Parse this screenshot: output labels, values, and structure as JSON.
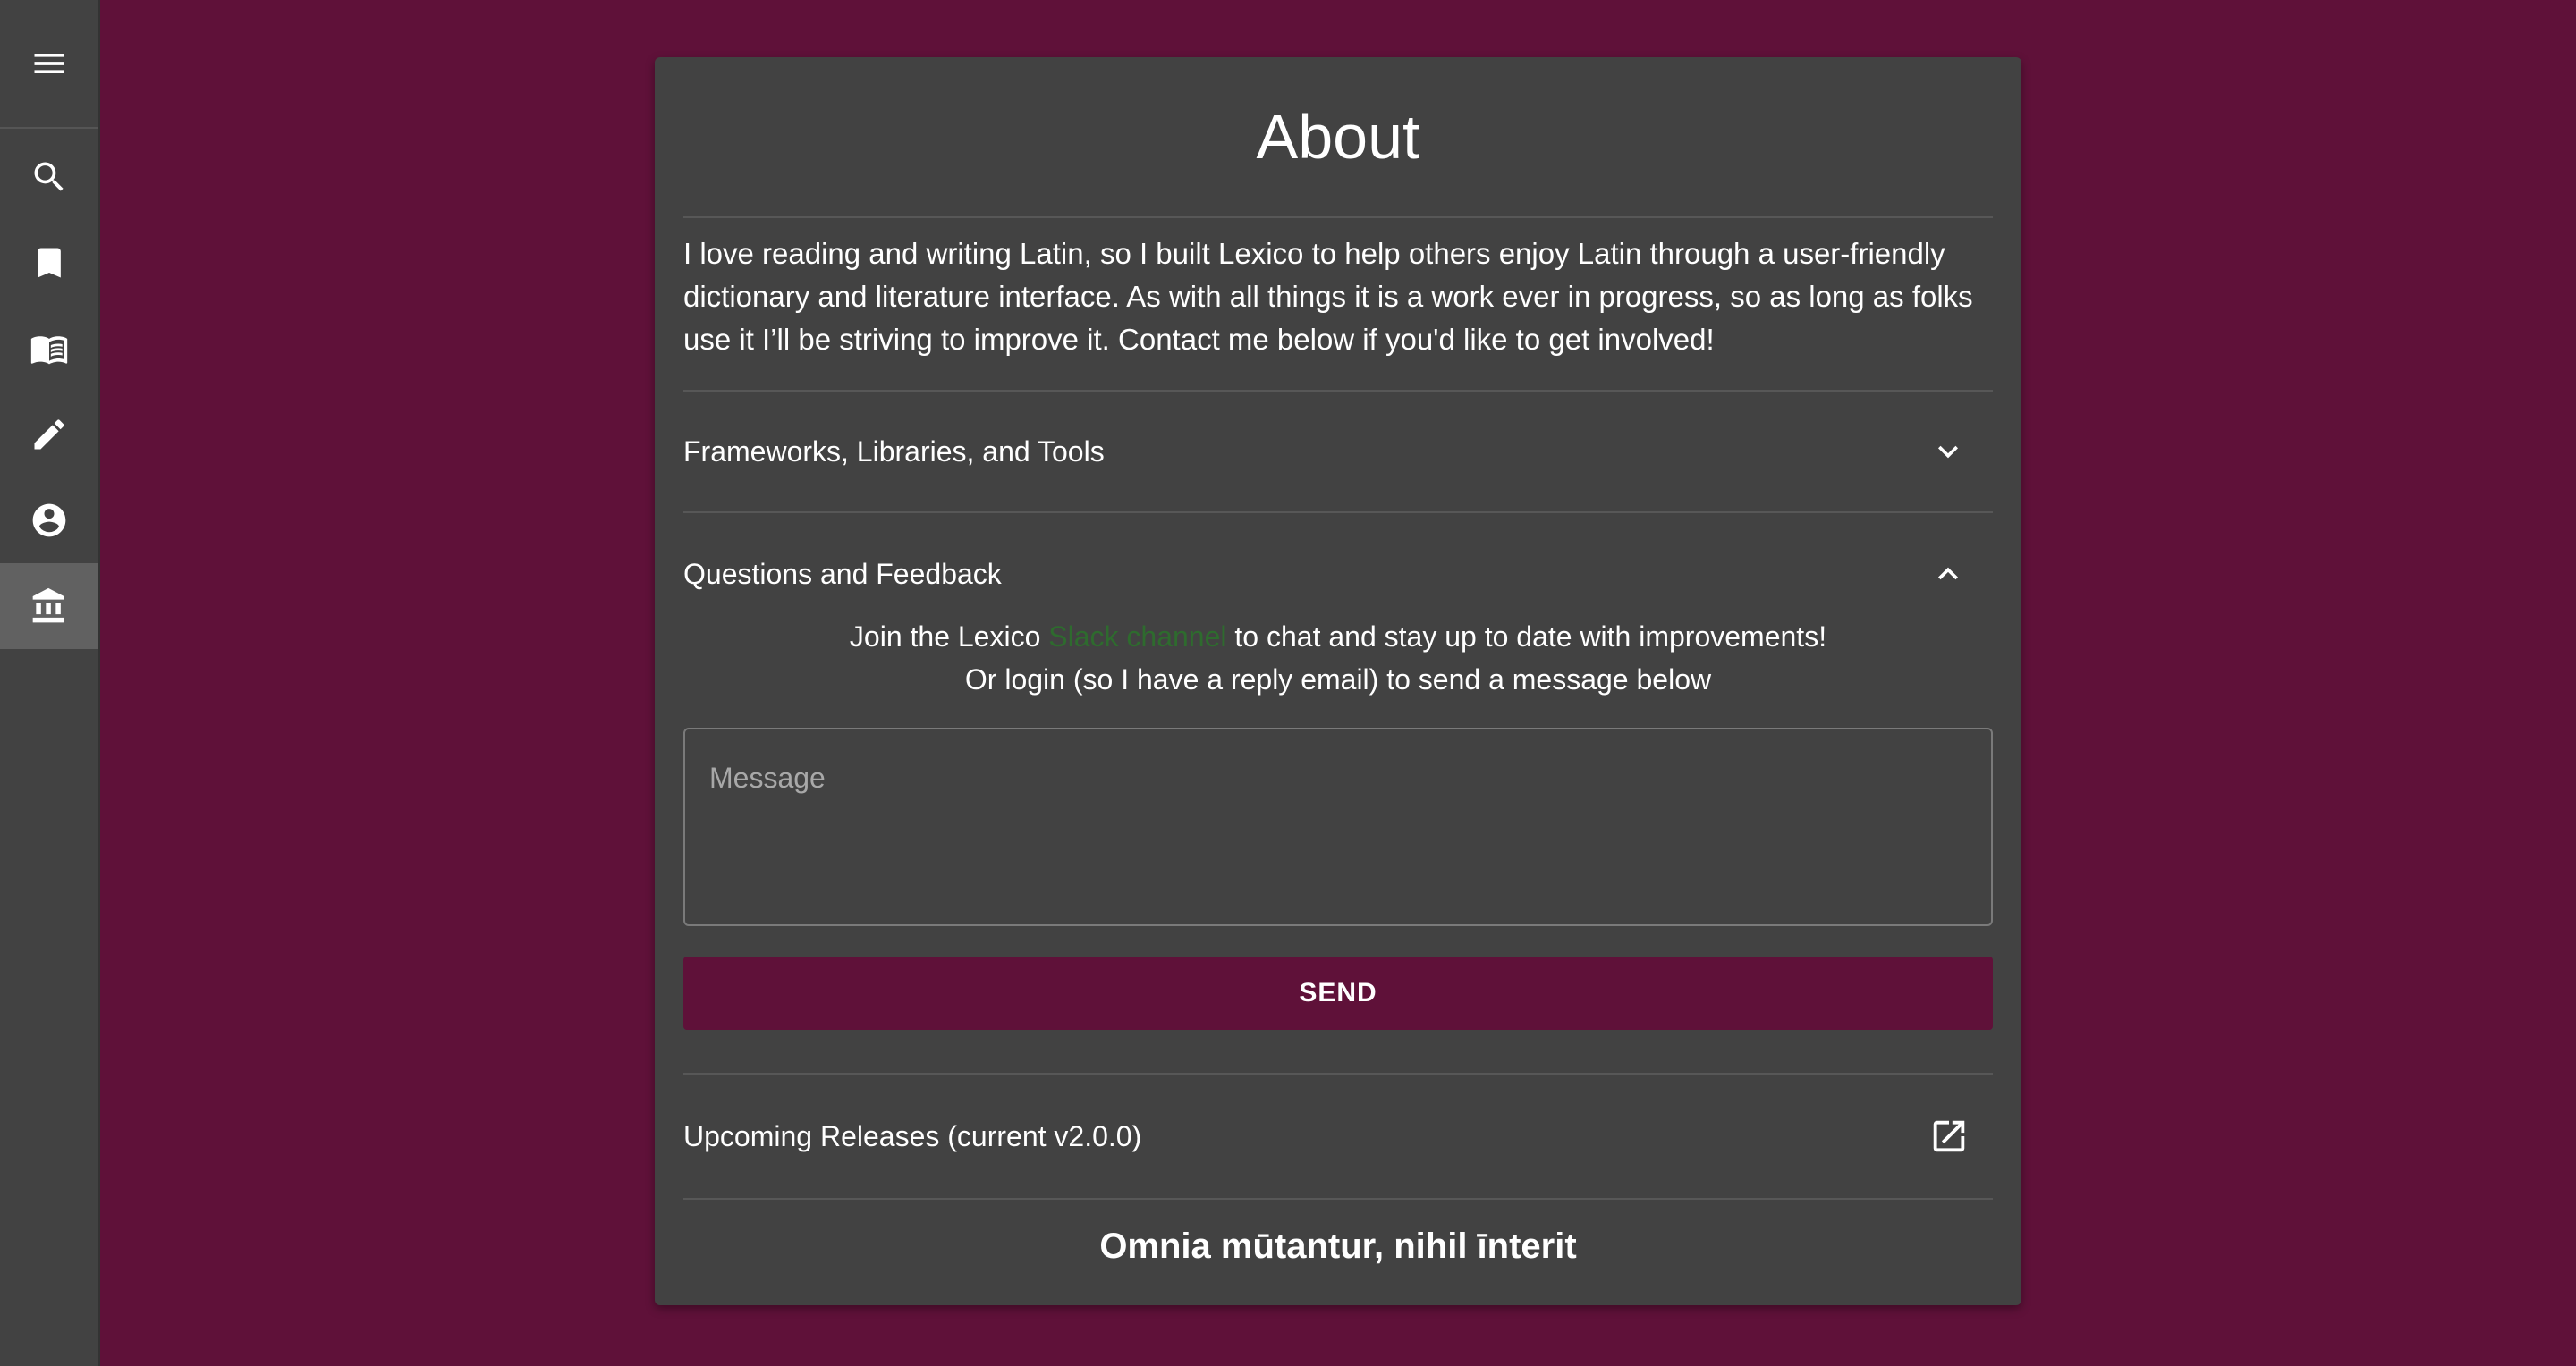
{
  "sidebar": {
    "menu_icon": "menu-icon",
    "items": [
      {
        "name": "search",
        "icon": "search-icon",
        "active": false
      },
      {
        "name": "bookmarks",
        "icon": "bookmark-icon",
        "active": false
      },
      {
        "name": "library",
        "icon": "book-open-icon",
        "active": false
      },
      {
        "name": "editor",
        "icon": "pencil-icon",
        "active": false
      },
      {
        "name": "account",
        "icon": "account-circle-icon",
        "active": false
      },
      {
        "name": "about",
        "icon": "bank-icon",
        "active": true
      }
    ]
  },
  "about": {
    "title": "About",
    "intro": "I love reading and writing Latin, so I built Lexico to help others enjoy Latin through a user-friendly dictionary and literature interface. As with all things it is a work ever in progress, so as long as folks use it I’ll be striving to improve it. Contact me below if you'd like to get involved!",
    "frameworks_label": "Frameworks, Libraries, and Tools",
    "questions_label": "Questions and Feedback",
    "join_prefix": "Join the Lexico ",
    "slack_link": "Slack channel",
    "join_suffix": " to chat and stay up to date with improvements!",
    "login_line": "Or login (so I have a reply email) to send a message below",
    "message_placeholder": "Message",
    "send_label": "SEND",
    "releases_label": "Upcoming Releases (current v2.0.0)",
    "motto": "Omnia mūtantur, nihil īnterit"
  },
  "colors": {
    "background": "#5f1139",
    "panel": "#424242",
    "link": "#2e6b2e"
  }
}
